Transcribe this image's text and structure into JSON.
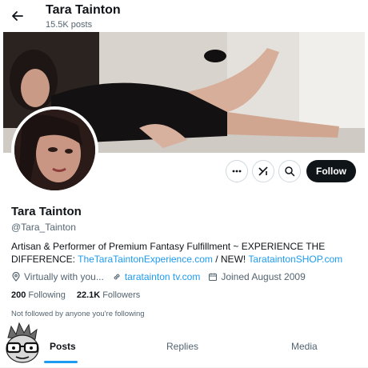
{
  "header": {
    "title": "Tara Tainton",
    "posts_count": "15.5K posts"
  },
  "profile": {
    "name": "Tara Tainton",
    "handle": "@Tara_Tainton",
    "bio_text": "Artisan & Performer of Premium Fantasy Fulfillment ~ EXPERIENCE THE DIFFERENCE: ",
    "bio_link1": "TheTaraTaintonExperience.com",
    "bio_sep": " / NEW! ",
    "bio_link2": "TarataintonSHOP.com",
    "location": "Virtually with you...",
    "website": "taratainton tv.com",
    "joined": "Joined August 2009",
    "following_count": "200",
    "following_label": "Following",
    "followers_count": "22.1K",
    "followers_label": "Followers",
    "not_followed": "Not followed by anyone you're following"
  },
  "actions": {
    "follow_label": "Follow",
    "more_icon": "more-icon",
    "grok_icon": "grok-icon",
    "search_icon": "search-icon"
  },
  "tabs": [
    {
      "label": "Posts",
      "active": true
    },
    {
      "label": "Replies",
      "active": false
    },
    {
      "label": "Media",
      "active": false
    }
  ],
  "colors": {
    "accent": "#1d9bf0",
    "follow_bg": "#0f1419",
    "secondary_text": "#536471"
  }
}
